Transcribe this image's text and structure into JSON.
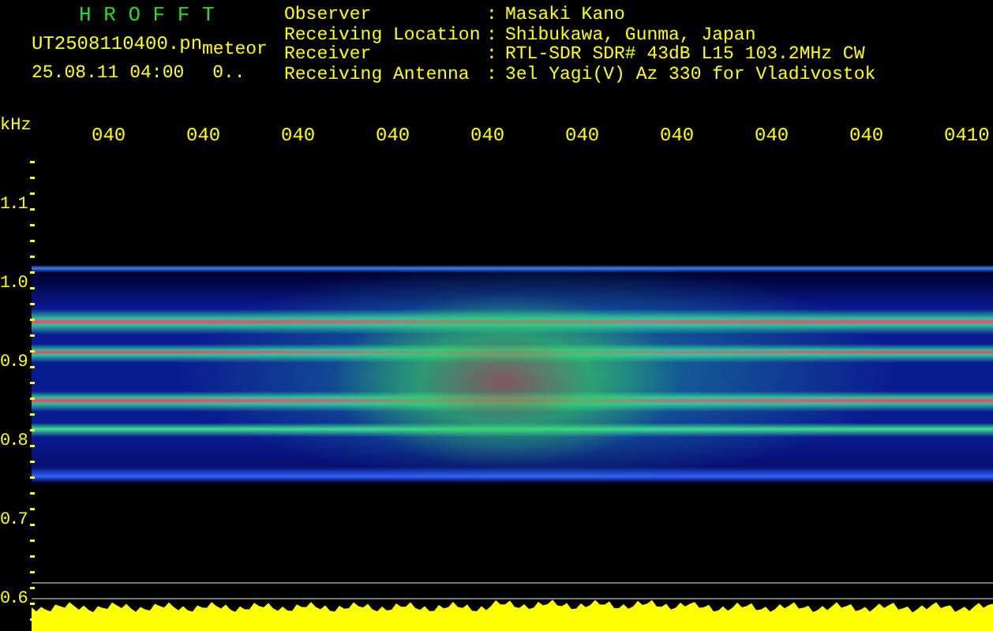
{
  "header": {
    "title": "H R O F F T",
    "filename": "UT2508110400.pn",
    "mode": "meteor",
    "datetime": "25.08.11 04:00",
    "value": "0.."
  },
  "station_info": [
    {
      "label": "Observer",
      "separator": ":",
      "value": "Masaki Kano"
    },
    {
      "label": "Receiving Location",
      "separator": ":",
      "value": "Shibukawa, Gunma, Japan"
    },
    {
      "label": "Receiver",
      "separator": ":",
      "value": "RTL-SDR SDR# 43dB L15 103.2MHz CW"
    },
    {
      "label": "Receiving Antenna",
      "separator": ":",
      "value": "3el Yagi(V) Az 330 for Vladivostok"
    }
  ],
  "frequency_axis": {
    "unit": "kHz",
    "ticks": [
      "1.1",
      "1.0",
      "0.9",
      "0.8",
      "0.7",
      "0.6"
    ]
  },
  "time_axis": {
    "ticks": [
      "040",
      "040",
      "040",
      "040",
      "040",
      "040",
      "040",
      "040",
      "040",
      "0410"
    ]
  }
}
